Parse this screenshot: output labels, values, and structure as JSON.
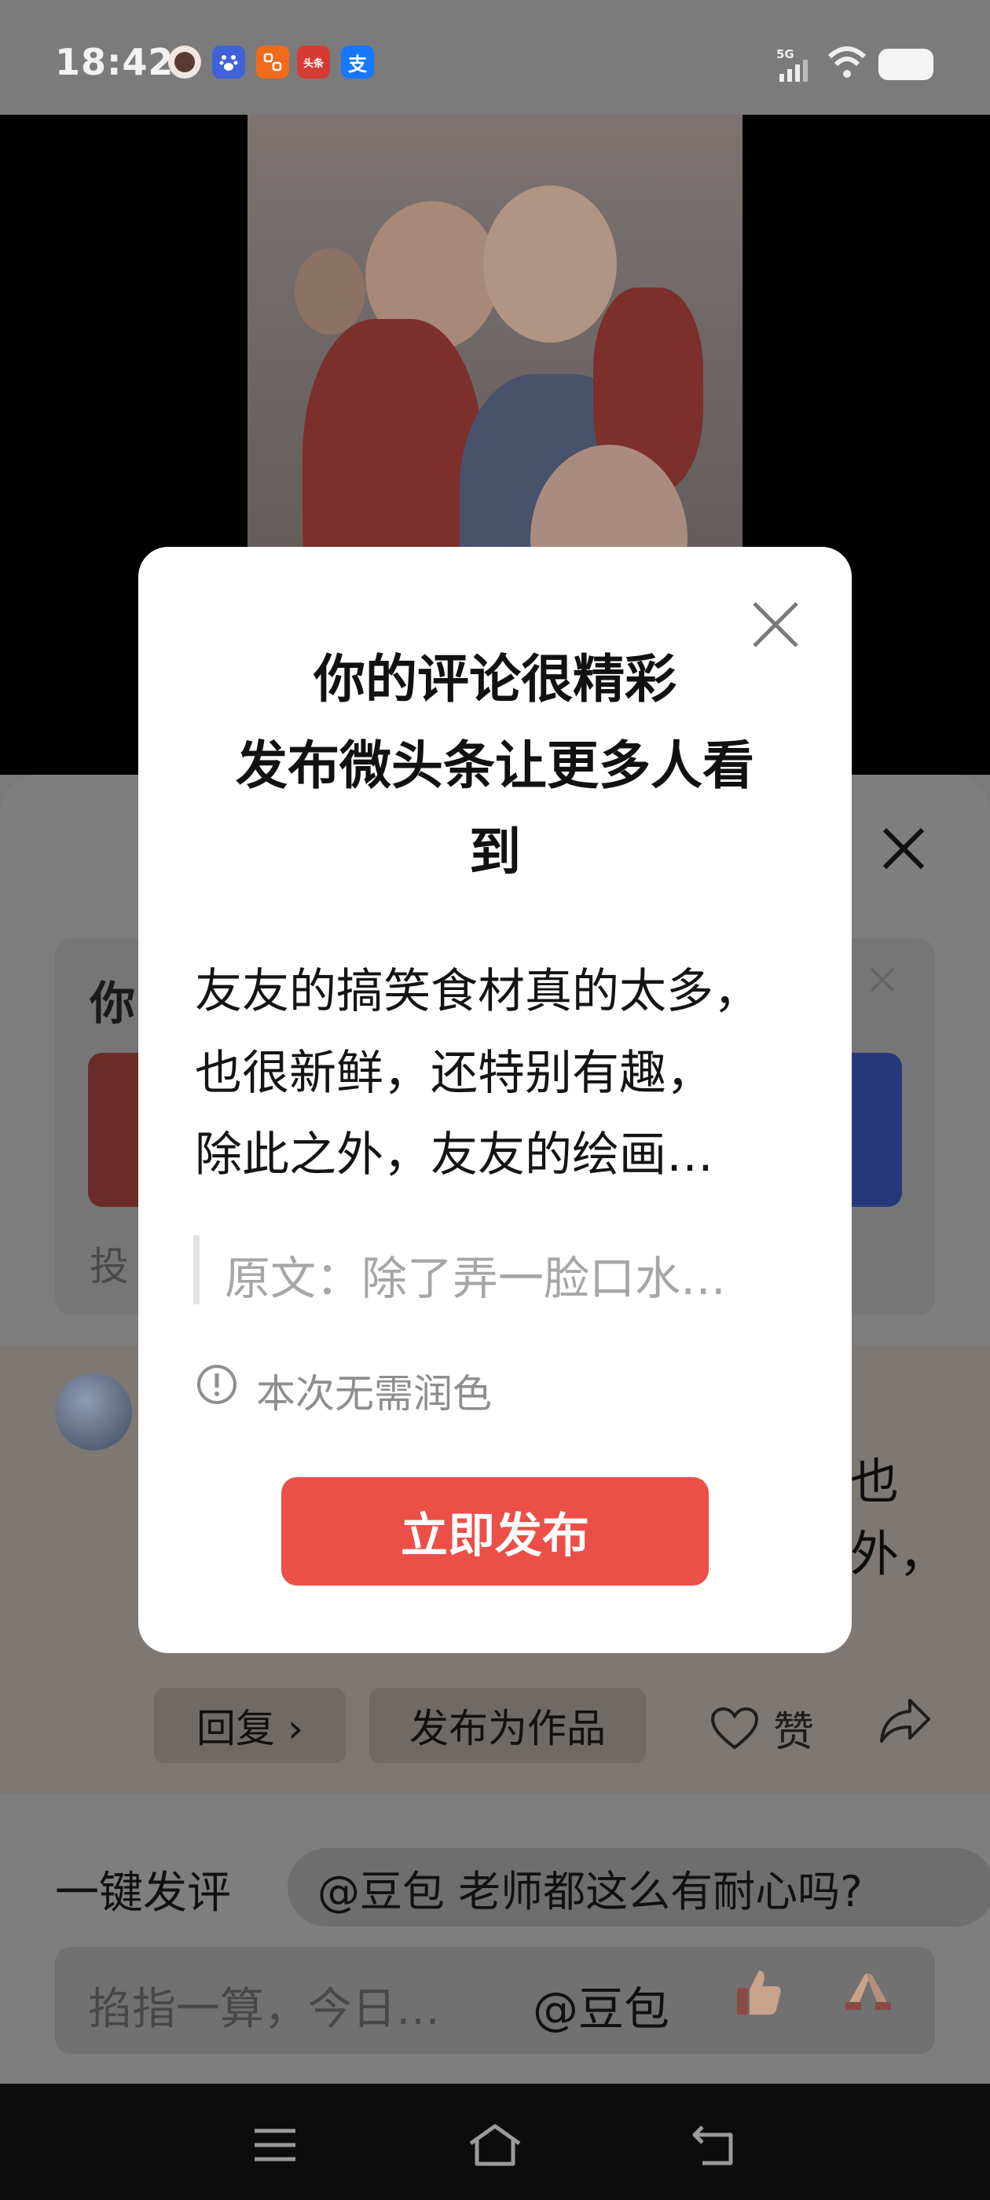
{
  "status_bar": {
    "time": "18:42",
    "network": "5G",
    "apps": [
      "avatar-app",
      "baidu",
      "app-orange",
      "头条",
      "支"
    ]
  },
  "colors": {
    "accent_red": "#ec4e48",
    "overlay": "#7a7a7a",
    "modal_bg": "#ffffff"
  },
  "background": {
    "vote_title": "你",
    "vote_footer": "投",
    "comment_tail": [
      "也",
      "外，"
    ],
    "reply_label": "回复 ›",
    "publish_work_label": "发布为作品",
    "like_label": "赞",
    "one_click_label": "一键发评",
    "suggestion_chip": "@豆包 老师都这么有耐心吗?",
    "input_placeholder": "掐指一算，今日…",
    "input_mention": "@豆包"
  },
  "modal": {
    "title_line1": "你的评论很精彩",
    "title_line2": "发布微头条让更多人看",
    "title_line3": "到",
    "body_line1": "友友的搞笑食材真的太多，",
    "body_line2": "也很新鲜，还特别有趣，",
    "body_line3": "除此之外，友友的绘画…",
    "original": "原文：除了弄一脸口水…",
    "info": "本次无需润色",
    "publish_button": "立即发布"
  }
}
